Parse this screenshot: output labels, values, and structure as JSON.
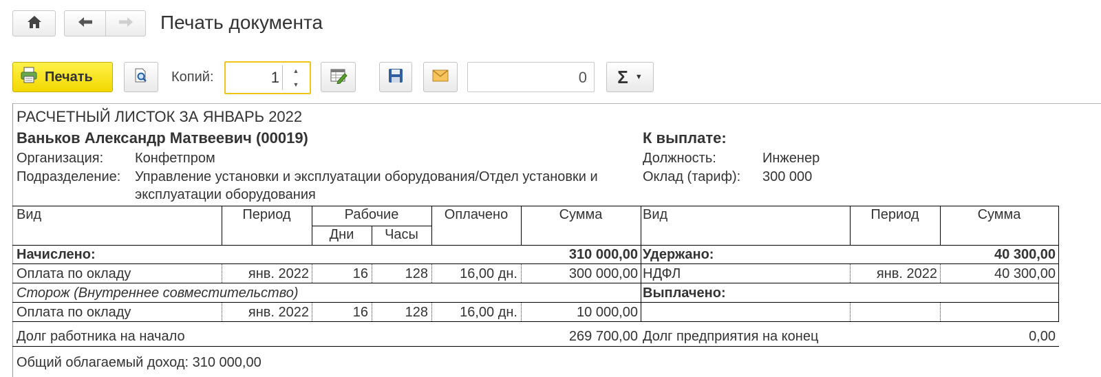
{
  "window": {
    "title": "Печать документа"
  },
  "toolbar": {
    "print_label": "Печать",
    "copies_label": "Копий:",
    "copies_value": "1",
    "counter_value": "0",
    "sum_label": "Σ"
  },
  "document": {
    "heading": "РАСЧЕТНЫЙ ЛИСТОК ЗА ЯНВАРЬ 2022",
    "employee": "Ваньков Александр Матвеевич (00019)",
    "to_pay_label": "К выплате:",
    "org_label": "Организация:",
    "org_value": "Конфетпром",
    "dept_label": "Подразделение:",
    "dept_value_line1": "Управление установки и эксплуатации оборудования/Отдел установки и",
    "dept_value_line2": "эксплуатации оборудования",
    "position_label": "Должность:",
    "position_value": "Инженер",
    "salary_label": "Оклад (тариф):",
    "salary_value": "300 000",
    "headers": {
      "vid": "Вид",
      "period": "Период",
      "working": "Рабочие",
      "days": "Дни",
      "hours": "Часы",
      "paid": "Оплачено",
      "sum": "Сумма",
      "vid2": "Вид",
      "period2": "Период",
      "sum2": "Сумма"
    },
    "accrued_label": "Начислено:",
    "accrued_total": "310 000,00",
    "withheld_label": "Удержано:",
    "withheld_total": "40 300,00",
    "row1": {
      "vid": "Оплата по окладу",
      "period": "янв. 2022",
      "days": "16",
      "hours": "128",
      "paid": "16,00 дн.",
      "sum": "300 000,00"
    },
    "row1_right": {
      "vid": "НДФЛ",
      "period": "янв. 2022",
      "sum": "40 300,00"
    },
    "section2": "Сторож (Внутреннее совместительство)",
    "paid_out_label": "Выплачено:",
    "row2": {
      "vid": "Оплата по окладу",
      "period": "янв. 2022",
      "days": "16",
      "hours": "128",
      "paid": "16,00 дн.",
      "sum": "10 000,00"
    },
    "debt_start_label": "Долг работника на начало",
    "debt_start_value": "269 700,00",
    "debt_end_label": "Долг предприятия на конец",
    "debt_end_value": "0,00",
    "taxable_income": "Общий облагаемый доход: 310 000,00"
  }
}
